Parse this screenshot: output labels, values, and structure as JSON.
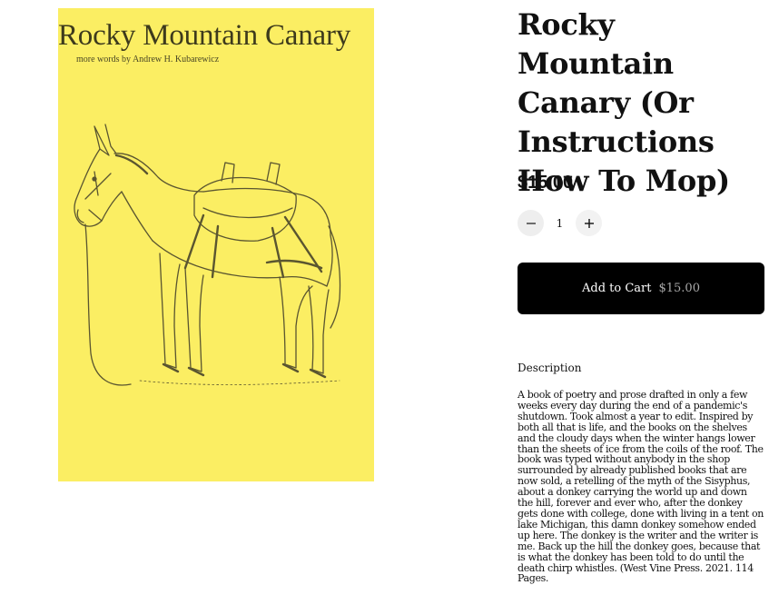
{
  "cover": {
    "title": "Rocky Mountain Canary",
    "subtitle": "more words by Andrew H. Kubarewicz",
    "background": "#fbee63",
    "image": "donkey-sketch"
  },
  "product": {
    "title": "Rocky Mountain Canary (Or Instructions How To Mop)",
    "price": "$15.00"
  },
  "quantity": {
    "decrement_icon": "minus-icon",
    "value": "1",
    "increment_icon": "plus-icon"
  },
  "cart": {
    "label": "Add to Cart",
    "price": "$15.00"
  },
  "description": {
    "heading": "Description",
    "text": "A book of poetry and prose drafted in only a few weeks every day during the end of a pandemic's shutdown. Took almost a year to edit. Inspired by both all that is life, and the books on the shelves and the cloudy days when the winter hangs lower than the sheets of ice from the coils of the roof. The book was typed without anybody in the shop surrounded by already published books that are now sold, a retelling of the myth of the Sisyphus, about a donkey carrying the world up and down the hill, forever and ever who, after the donkey gets done with college, done with living in a tent on lake Michigan, this damn donkey somehow ended up here. The donkey is the writer and the writer is me. Back up the hill the donkey goes, because that is what the donkey has been told to do until the death chirp whistles. (West Vine Press. 2021. 114 Pages."
  }
}
